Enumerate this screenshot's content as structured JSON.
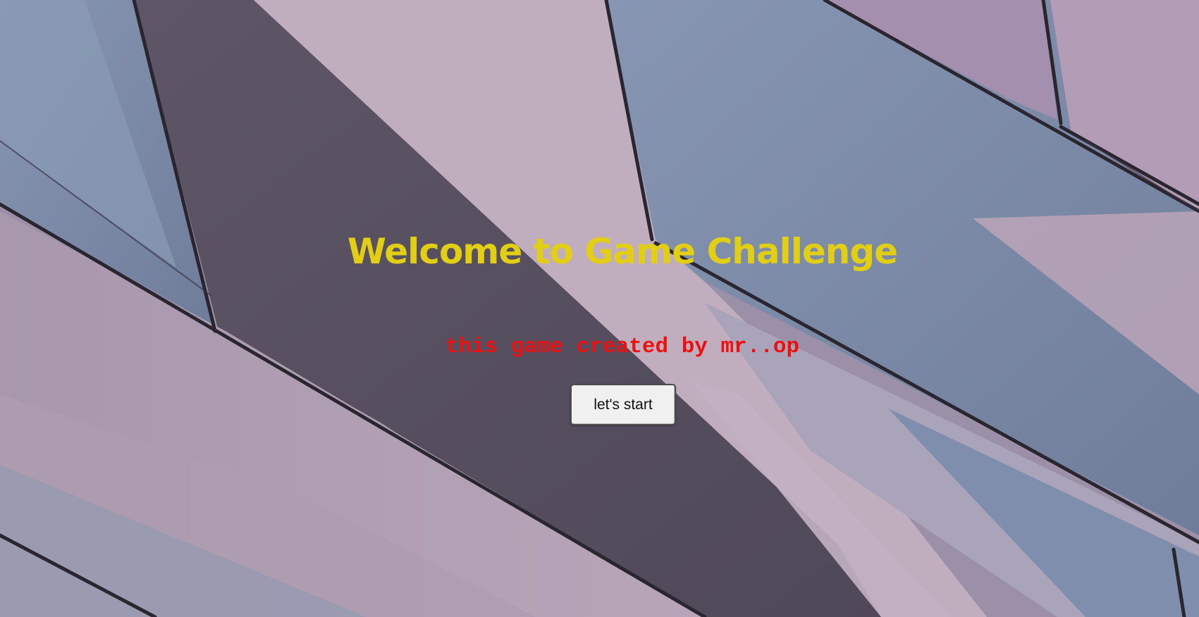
{
  "page": {
    "title": "Welcome to Game Challenge",
    "subtitle": "this game created by mr..op",
    "start_button_label": "let's start"
  },
  "colors": {
    "title": "#e2cf14",
    "subtitle": "#ee0f0f",
    "button_background": "#f0f0f0",
    "background_light": "#bfa9ba",
    "background_blue": "#7d8aa6",
    "background_dark": "#5b5466"
  }
}
